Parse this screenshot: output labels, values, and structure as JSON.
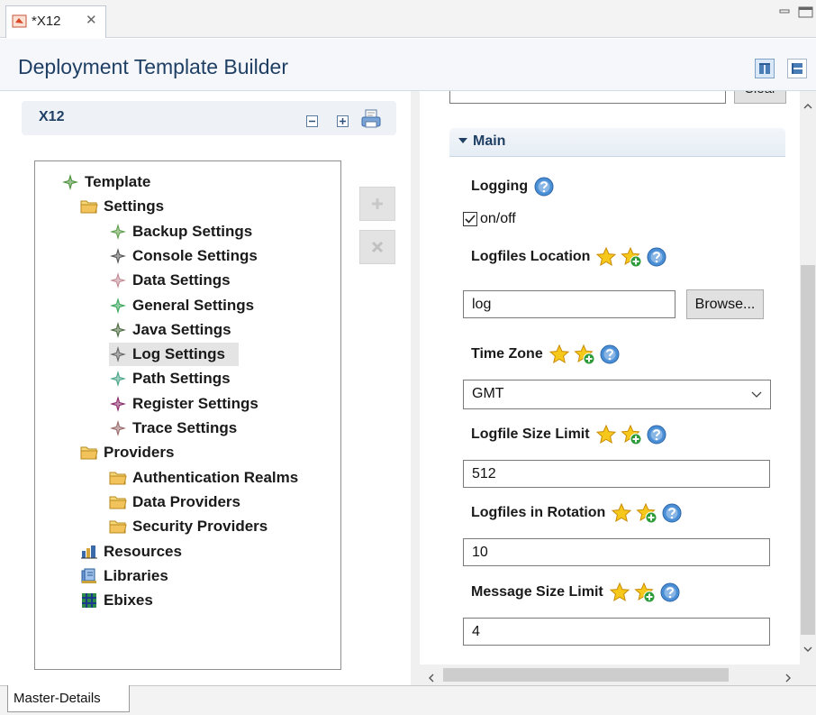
{
  "editor_tab": {
    "title": "*X12",
    "close_glyph": "✕",
    "icon": "template-editor-icon"
  },
  "window_controls": {
    "minimize_icon": "minimize-icon",
    "maximize_icon": "maximize-icon"
  },
  "header": {
    "title": "Deployment Template Builder",
    "layout_icons": [
      "horizontal-layout-icon",
      "vertical-layout-icon"
    ]
  },
  "master": {
    "section_title": "X12",
    "tools": [
      "collapse-all-icon",
      "expand-all-icon",
      "print-icon"
    ],
    "side_buttons": [
      "add-icon",
      "remove-icon"
    ],
    "tree": [
      {
        "label": "Template",
        "icon": "template-icon",
        "color": "#4a8f3a",
        "depth": 0,
        "selected": false
      },
      {
        "label": "Settings",
        "icon": "folder-icon",
        "color": "#e8b84a",
        "depth": 1,
        "selected": false
      },
      {
        "label": "Backup Settings",
        "icon": "settings-node-icon",
        "color": "#5f9e4a",
        "depth": 2,
        "selected": false
      },
      {
        "label": "Console Settings",
        "icon": "settings-node-icon",
        "color": "#555555",
        "depth": 2,
        "selected": false
      },
      {
        "label": "Data Settings",
        "icon": "settings-node-icon",
        "color": "#c48a95",
        "depth": 2,
        "selected": false
      },
      {
        "label": "General Settings",
        "icon": "settings-node-icon",
        "color": "#3aa65a",
        "depth": 2,
        "selected": false
      },
      {
        "label": "Java Settings",
        "icon": "settings-node-icon",
        "color": "#4a6a3f",
        "depth": 2,
        "selected": false
      },
      {
        "label": "Log Settings",
        "icon": "settings-node-icon",
        "color": "#666666",
        "depth": 2,
        "selected": true
      },
      {
        "label": "Path Settings",
        "icon": "settings-node-icon",
        "color": "#4aa58a",
        "depth": 2,
        "selected": false
      },
      {
        "label": "Register Settings",
        "icon": "settings-node-icon",
        "color": "#8a2a6a",
        "depth": 2,
        "selected": false
      },
      {
        "label": "Trace Settings",
        "icon": "settings-node-icon",
        "color": "#9a6a6a",
        "depth": 2,
        "selected": false
      },
      {
        "label": "Providers",
        "icon": "folder-icon",
        "color": "#e8b84a",
        "depth": 1,
        "selected": false
      },
      {
        "label": "Authentication Realms",
        "icon": "folder-icon",
        "color": "#e8b84a",
        "depth": 2,
        "selected": false
      },
      {
        "label": "Data Providers",
        "icon": "folder-icon",
        "color": "#e8b84a",
        "depth": 2,
        "selected": false
      },
      {
        "label": "Security Providers",
        "icon": "folder-icon",
        "color": "#e8b84a",
        "depth": 2,
        "selected": false
      },
      {
        "label": "Resources",
        "icon": "resources-icon",
        "color": "#3a5a9a",
        "depth": 1,
        "selected": false
      },
      {
        "label": "Libraries",
        "icon": "libraries-icon",
        "color": "#3a6aaa",
        "depth": 1,
        "selected": false
      },
      {
        "label": "Ebixes",
        "icon": "ebixes-icon",
        "color": "#1a6a3a",
        "depth": 1,
        "selected": false
      }
    ]
  },
  "details": {
    "top_clear_label": "Clear",
    "section_title": "Main",
    "logging": {
      "label": "Logging",
      "checkbox_label": "on/off",
      "checked": true
    },
    "logfiles_location": {
      "label": "Logfiles Location",
      "value": "log",
      "browse_label": "Browse..."
    },
    "time_zone": {
      "label": "Time Zone",
      "value": "GMT"
    },
    "logfile_size_limit": {
      "label": "Logfile Size Limit",
      "value": "512"
    },
    "logfiles_in_rotation": {
      "label": "Logfiles in Rotation",
      "value": "10"
    },
    "message_size_limit": {
      "label": "Message Size Limit",
      "value": "4"
    }
  },
  "bottom": {
    "tab_label": "Master-Details"
  }
}
